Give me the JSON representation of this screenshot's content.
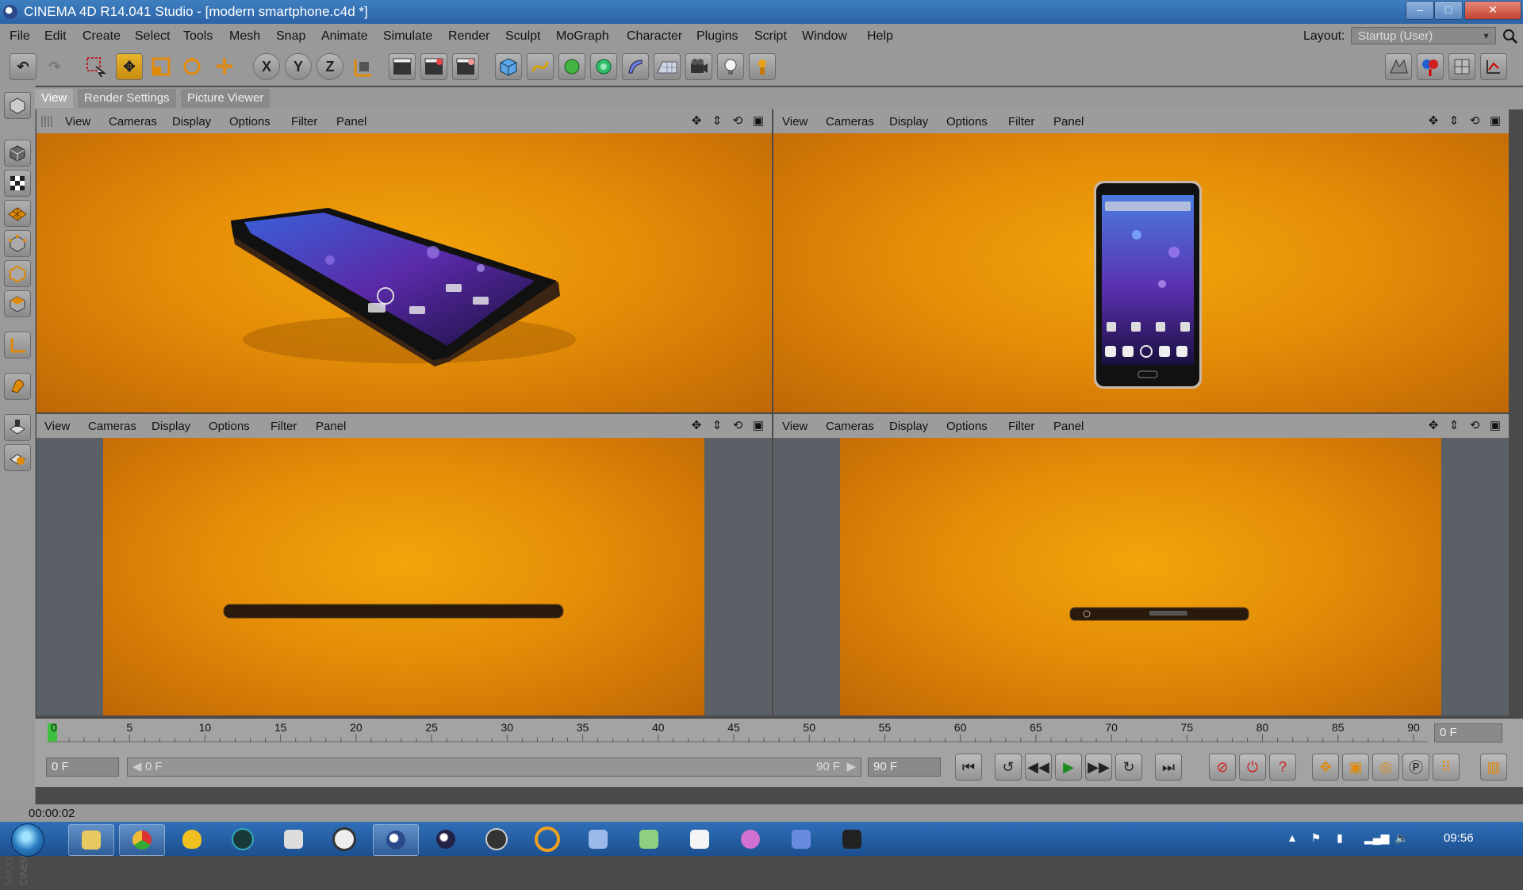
{
  "window": {
    "title": "CINEMA 4D R14.041 Studio - [modern smartphone.c4d *]",
    "controls": {
      "minimize": "–",
      "maximize": "□",
      "close": "✕"
    }
  },
  "menubar": {
    "items": [
      "File",
      "Edit",
      "Create",
      "Select",
      "Tools",
      "Mesh",
      "Snap",
      "Animate",
      "Simulate",
      "Render",
      "Sculpt",
      "MoGraph",
      "Character",
      "Plugins",
      "Script",
      "Window",
      "Help"
    ],
    "layout_label": "Layout:",
    "layout_value": "Startup (User)"
  },
  "toolbar": {
    "axis_x": "X",
    "axis_y": "Y",
    "axis_z": "Z",
    "icons": [
      "undo-icon",
      "redo-icon",
      "live-selection-icon",
      "move-icon",
      "scale-icon",
      "rotate-icon",
      "add-icon",
      "x-axis-lock-icon",
      "y-axis-lock-icon",
      "z-axis-lock-icon",
      "coordinate-system-icon",
      "render-view-icon",
      "render-picture-viewer-icon",
      "render-settings-icon",
      "cube-icon",
      "spline-icon",
      "nurbs-icon",
      "array-icon",
      "deformer-icon",
      "floor-icon",
      "camera-icon",
      "light-icon",
      "tag-icon"
    ]
  },
  "tabs": [
    "View",
    "Render Settings",
    "Picture Viewer"
  ],
  "viewport_menu": [
    "View",
    "Cameras",
    "Display",
    "Options",
    "Filter",
    "Panel"
  ],
  "viewport_icons": [
    "✥",
    "⇕",
    "⟲",
    "▣"
  ],
  "timeline": {
    "ticks": [
      "0",
      "5",
      "10",
      "15",
      "20",
      "25",
      "30",
      "35",
      "40",
      "45",
      "50",
      "55",
      "60",
      "65",
      "70",
      "75",
      "80",
      "85",
      "90"
    ],
    "current_frame_right": "0 F"
  },
  "transport": {
    "current_frame": "0 F",
    "range_start": "0 F",
    "range_end": "90 F",
    "end_frame": "90 F"
  },
  "status": {
    "text": "00:00:02"
  },
  "taskbar": {
    "clock": "09:56",
    "apps": [
      "file-explorer",
      "chrome",
      "app-yellow",
      "app-globe",
      "app-document",
      "app-circle",
      "cinema4d",
      "app-blue-sphere",
      "app-dark-sphere",
      "app-orange-ring",
      "app-plane",
      "app-files",
      "app-calendar",
      "app-flower",
      "app-window",
      "app-terminal"
    ]
  },
  "colors": {
    "viewport_bg": "#e69b09",
    "ui_gray": "#999999",
    "taskbar": "#2a63a6"
  }
}
